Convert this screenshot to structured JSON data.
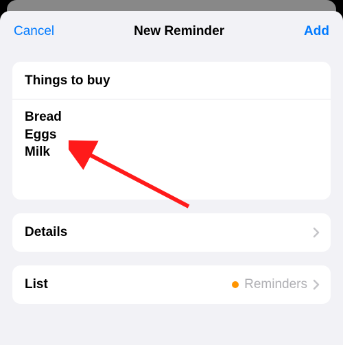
{
  "nav": {
    "cancel": "Cancel",
    "title": "New Reminder",
    "add": "Add"
  },
  "reminder": {
    "title": "Things to buy",
    "notes": [
      "Bread",
      "Eggs",
      "Milk"
    ]
  },
  "rows": {
    "details": {
      "label": "Details"
    },
    "list": {
      "label": "List",
      "value": "Reminders",
      "dotColor": "#ff9500"
    }
  }
}
